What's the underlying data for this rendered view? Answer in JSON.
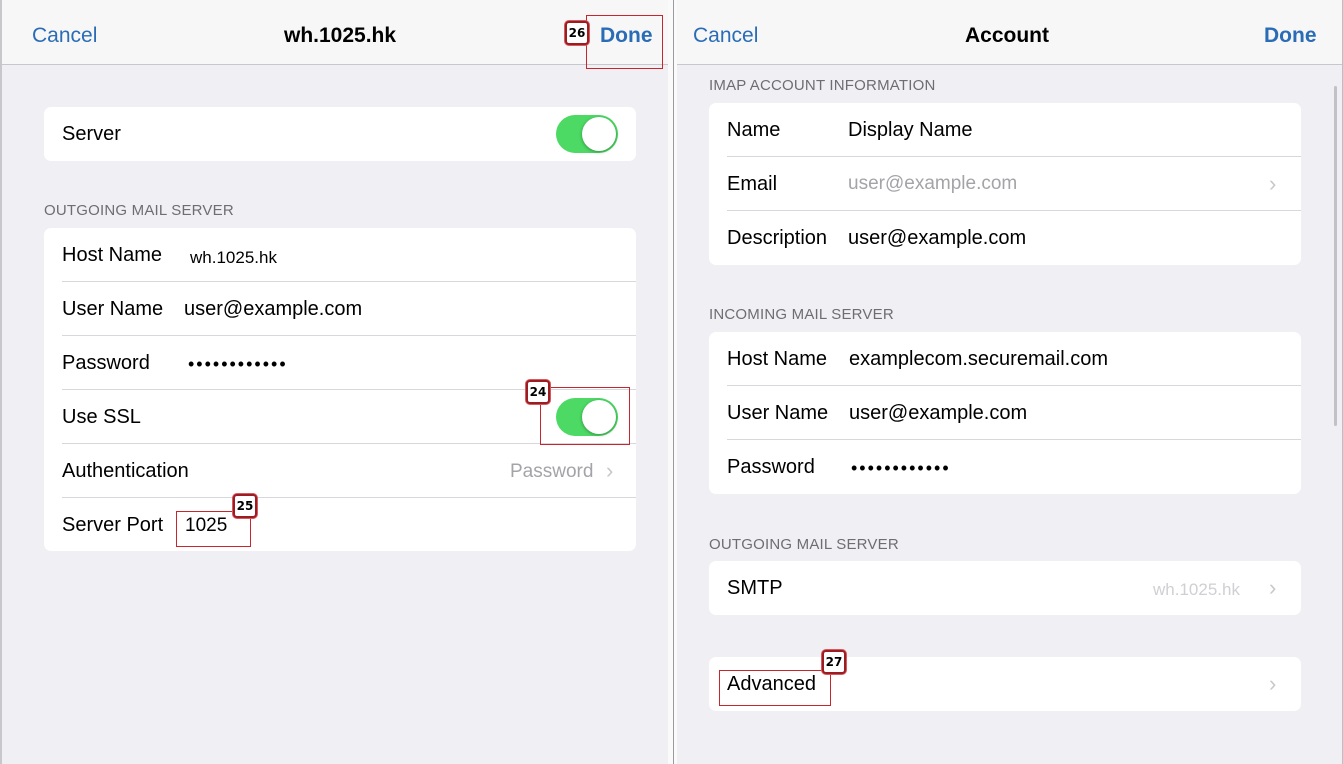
{
  "left": {
    "nav": {
      "cancel": "Cancel",
      "title": "wh.1025.hk",
      "done": "Done"
    },
    "server_row": {
      "label": "Server",
      "toggle_on": true
    },
    "outgoing_header": "OUTGOING MAIL SERVER",
    "rows": {
      "host_name": {
        "label": "Host Name",
        "value": "wh.1025.hk"
      },
      "user_name": {
        "label": "User Name",
        "value": "user@example.com"
      },
      "password": {
        "label": "Password",
        "value": "••••••••••••"
      },
      "use_ssl": {
        "label": "Use SSL",
        "toggle_on": true
      },
      "authentication": {
        "label": "Authentication",
        "value": "Password"
      },
      "server_port": {
        "label": "Server Port",
        "value": "1025"
      }
    }
  },
  "right": {
    "nav": {
      "cancel": "Cancel",
      "title": "Account",
      "done": "Done"
    },
    "imap_header": "IMAP ACCOUNT INFORMATION",
    "imap": {
      "name": {
        "label": "Name",
        "value": "Display Name"
      },
      "email": {
        "label": "Email",
        "value": "user@example.com"
      },
      "description": {
        "label": "Description",
        "value": "user@example.com"
      }
    },
    "incoming_header": "INCOMING MAIL SERVER",
    "incoming": {
      "host_name": {
        "label": "Host Name",
        "value": "examplecom.securemail.com"
      },
      "user_name": {
        "label": "User Name",
        "value": "user@example.com"
      },
      "password": {
        "label": "Password",
        "value": "••••••••••••"
      }
    },
    "outgoing_header": "OUTGOING MAIL SERVER",
    "smtp": {
      "label": "SMTP",
      "value": "wh.1025.hk"
    },
    "advanced": {
      "label": "Advanced"
    }
  },
  "annotations": {
    "a24": "24",
    "a25": "25",
    "a26": "26",
    "a27": "27"
  },
  "icons": {
    "chevron": "chevron-right-icon",
    "toggle": "toggle-switch"
  },
  "colors": {
    "accent": "#2a6db6",
    "toggle_on": "#4cd964",
    "annotation": "#c8262d"
  }
}
